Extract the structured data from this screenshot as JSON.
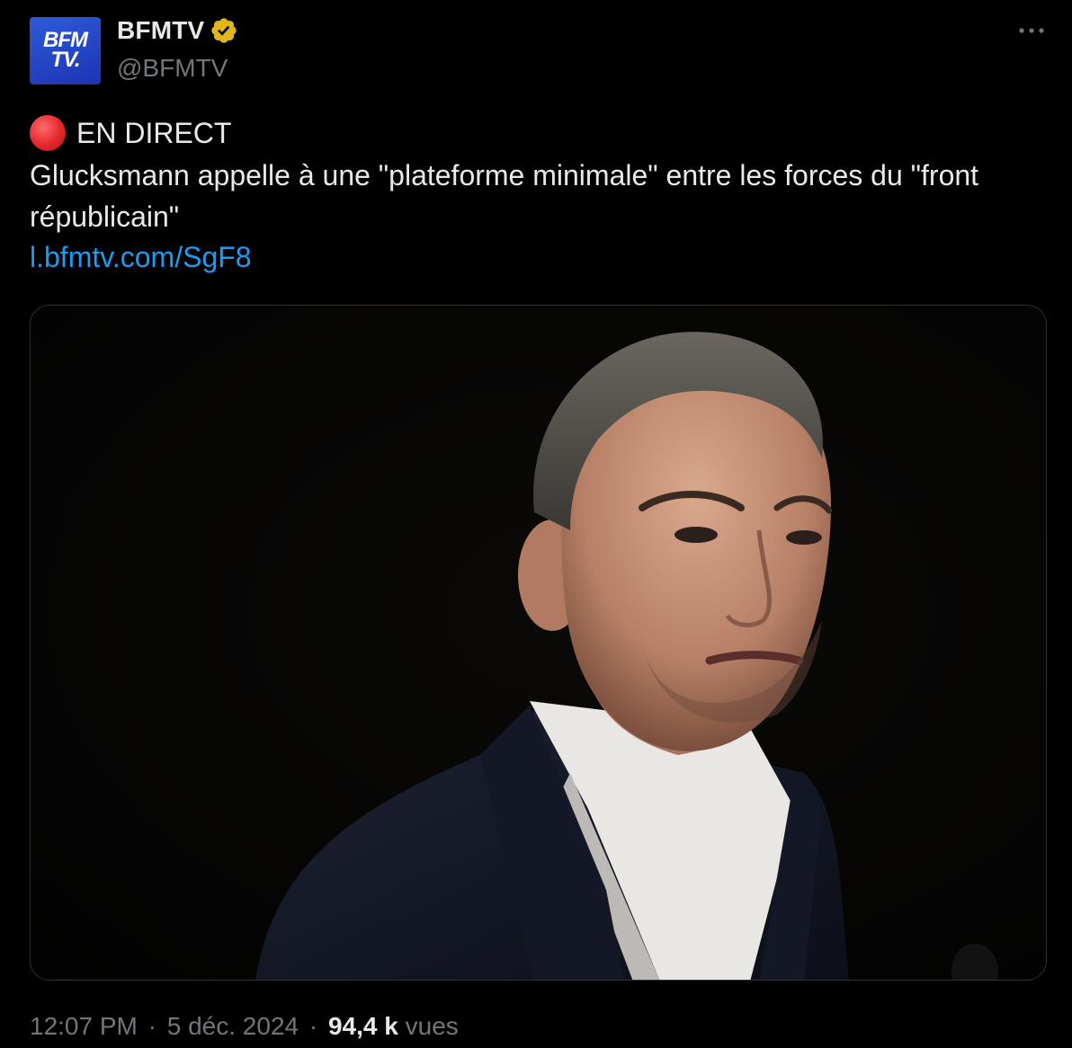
{
  "author": {
    "display_name": "BFMTV",
    "handle": "@BFMTV",
    "avatar_text_line1": "BFM",
    "avatar_text_line2": "TV.",
    "verified_color": "#e2b719"
  },
  "tweet": {
    "live_label": "EN DIRECT",
    "headline": "Glucksmann appelle à une \"plateforme minimale\" entre les forces du \"front républicain\"",
    "link_text": "l.bfmtv.com/SgF8",
    "live_dot_color": "#e3272b",
    "link_color": "#1d9bf0"
  },
  "media": {
    "alt": "photo"
  },
  "meta": {
    "time": "12:07 PM",
    "separator": "·",
    "date": "5 déc. 2024",
    "views_count": "94,4 k",
    "views_label": "vues"
  },
  "icons": {
    "more": "more-horizontal-icon",
    "verified": "verified-badge-icon",
    "live": "red-circle-icon"
  }
}
